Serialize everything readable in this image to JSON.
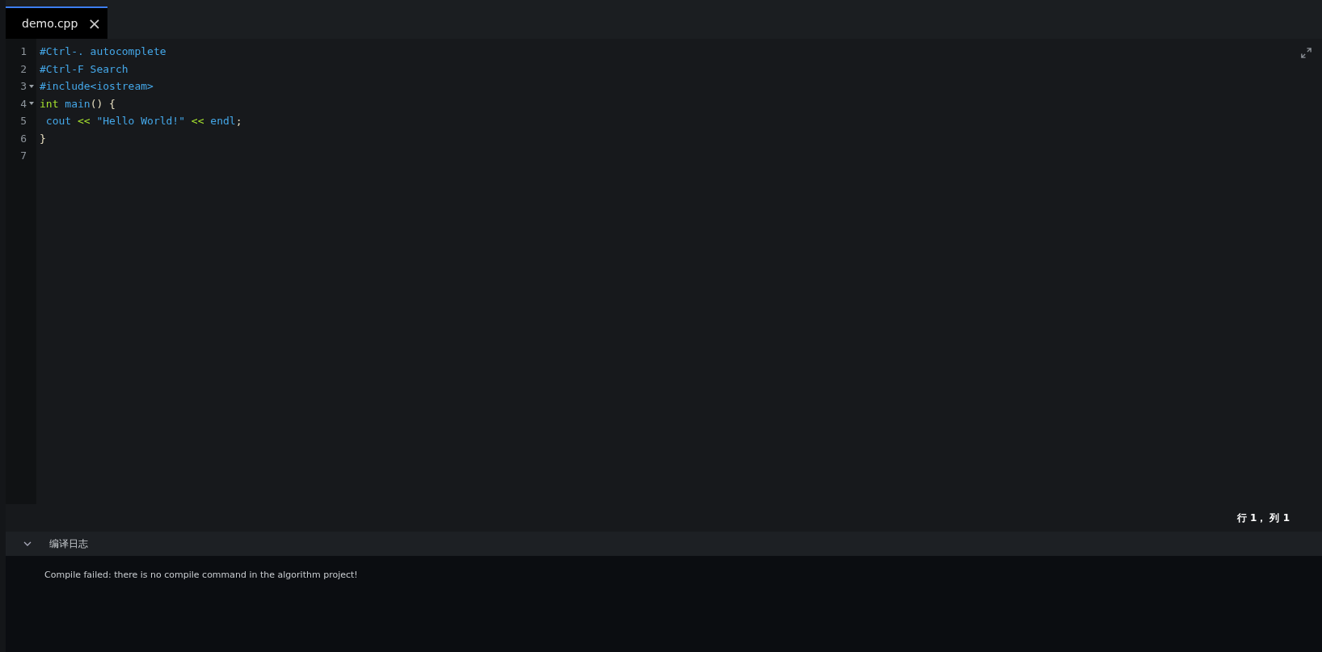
{
  "tabs": [
    {
      "label": "demo.cpp",
      "selected": true,
      "close": "×"
    }
  ],
  "editor": {
    "lines": [
      {
        "number": "1",
        "foldable": false,
        "tokens": [
          {
            "kind": "ident",
            "text": "#Ctrl-. autocomplete"
          }
        ]
      },
      {
        "number": "2",
        "foldable": false,
        "tokens": [
          {
            "kind": "ident",
            "text": "#Ctrl-F Search"
          }
        ]
      },
      {
        "number": "3",
        "foldable": true,
        "tokens": [
          {
            "kind": "ident",
            "text": "#include<iostream>"
          }
        ]
      },
      {
        "number": "4",
        "foldable": true,
        "tokens": [
          {
            "kind": "keyword",
            "text": "int"
          },
          {
            "kind": "ident",
            "text": " main"
          },
          {
            "kind": "punct",
            "text": "() {"
          }
        ]
      },
      {
        "number": "5",
        "foldable": false,
        "tokens": [
          {
            "kind": "ident",
            "text": " cout"
          },
          {
            "kind": "keyword",
            "text": " <<"
          },
          {
            "kind": "ident",
            "text": " \"Hello World!\""
          },
          {
            "kind": "keyword",
            "text": " <<"
          },
          {
            "kind": "ident",
            "text": " endl"
          },
          {
            "kind": "punct",
            "text": ";"
          }
        ]
      },
      {
        "number": "6",
        "foldable": false,
        "tokens": [
          {
            "kind": "punct",
            "text": "}"
          }
        ]
      },
      {
        "number": "7",
        "foldable": false
      }
    ]
  },
  "status_bar": {
    "cursor": "行 1， 列 1"
  },
  "log_panel": {
    "title": "编译日志",
    "expanded": true,
    "message": "Compile failed: there is no compile command in the algorithm project!"
  }
}
